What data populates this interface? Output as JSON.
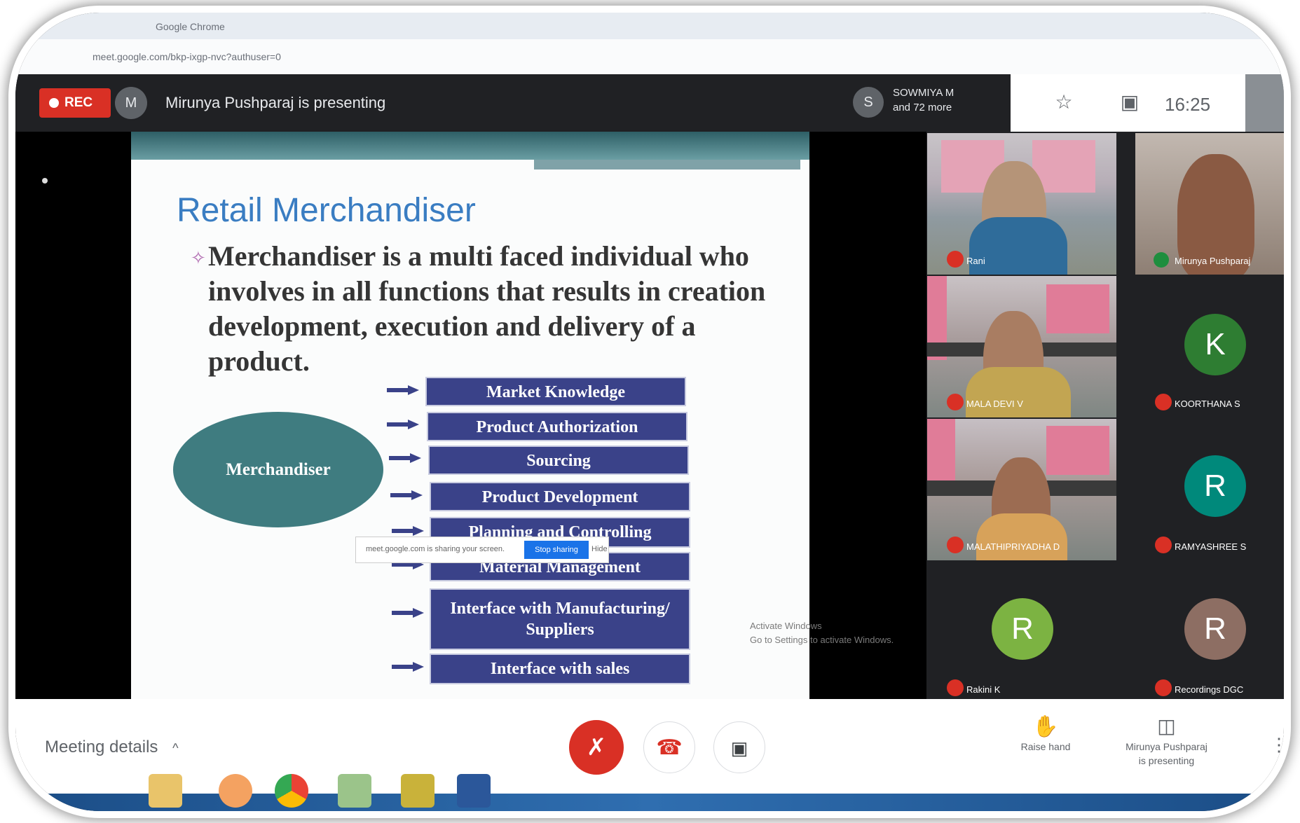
{
  "browser": {
    "title": "Google Chrome",
    "url": "meet.google.com/bkp-ixgp-nvc?authuser=0"
  },
  "meet": {
    "rec_label": "REC",
    "presenter_initial": "M",
    "presenting_text": "Mirunya Pushparaj is presenting",
    "others_initial": "S",
    "others_line1": "SOWMIYA M",
    "others_line2": "and 72 more",
    "clock": "16:25"
  },
  "slide": {
    "title": "Retail Merchandiser",
    "bullet": "Merchandiser is a multi faced individual who involves in all functions that results in creation development, execution and delivery of a product.",
    "center_node": "Merchandiser",
    "items": [
      "Market Knowledge",
      "Product Authorization",
      "Sourcing",
      "Product Development",
      "Planning and Controlling",
      "Material Management",
      "Interface with Manufacturing/ Suppliers",
      "Interface with sales"
    ],
    "sharing_popup_text": "meet.google.com is sharing your screen.",
    "sharing_popup_button": "Stop sharing",
    "sharing_popup_hide": "Hide",
    "watermark_line1": "Activate Windows",
    "watermark_line2": "Go to Settings to activate Windows."
  },
  "participants": [
    {
      "name": "Rani",
      "type": "video"
    },
    {
      "name": "Mirunya Pushparaj",
      "type": "video"
    },
    {
      "name": "MALA DEVI V",
      "type": "video"
    },
    {
      "name": "KOORTHANA S",
      "type": "avatar",
      "initial": "K",
      "color": "#2e7d32"
    },
    {
      "name": "MALATHIPRIYADHA D",
      "type": "video"
    },
    {
      "name": "RAMYASHREE S",
      "type": "avatar",
      "initial": "R",
      "color": "#00897b"
    },
    {
      "name": "Rakini K",
      "type": "avatar",
      "initial": "R",
      "color": "#7cb342"
    },
    {
      "name": "Recordings DGC",
      "type": "avatar",
      "initial": "R",
      "color": "#8d6e63"
    }
  ],
  "controls": {
    "meeting_details": "Meeting details",
    "raise_hand": "Raise hand",
    "presenting_line1": "Mirunya Pushparaj",
    "presenting_line2": "is presenting"
  }
}
